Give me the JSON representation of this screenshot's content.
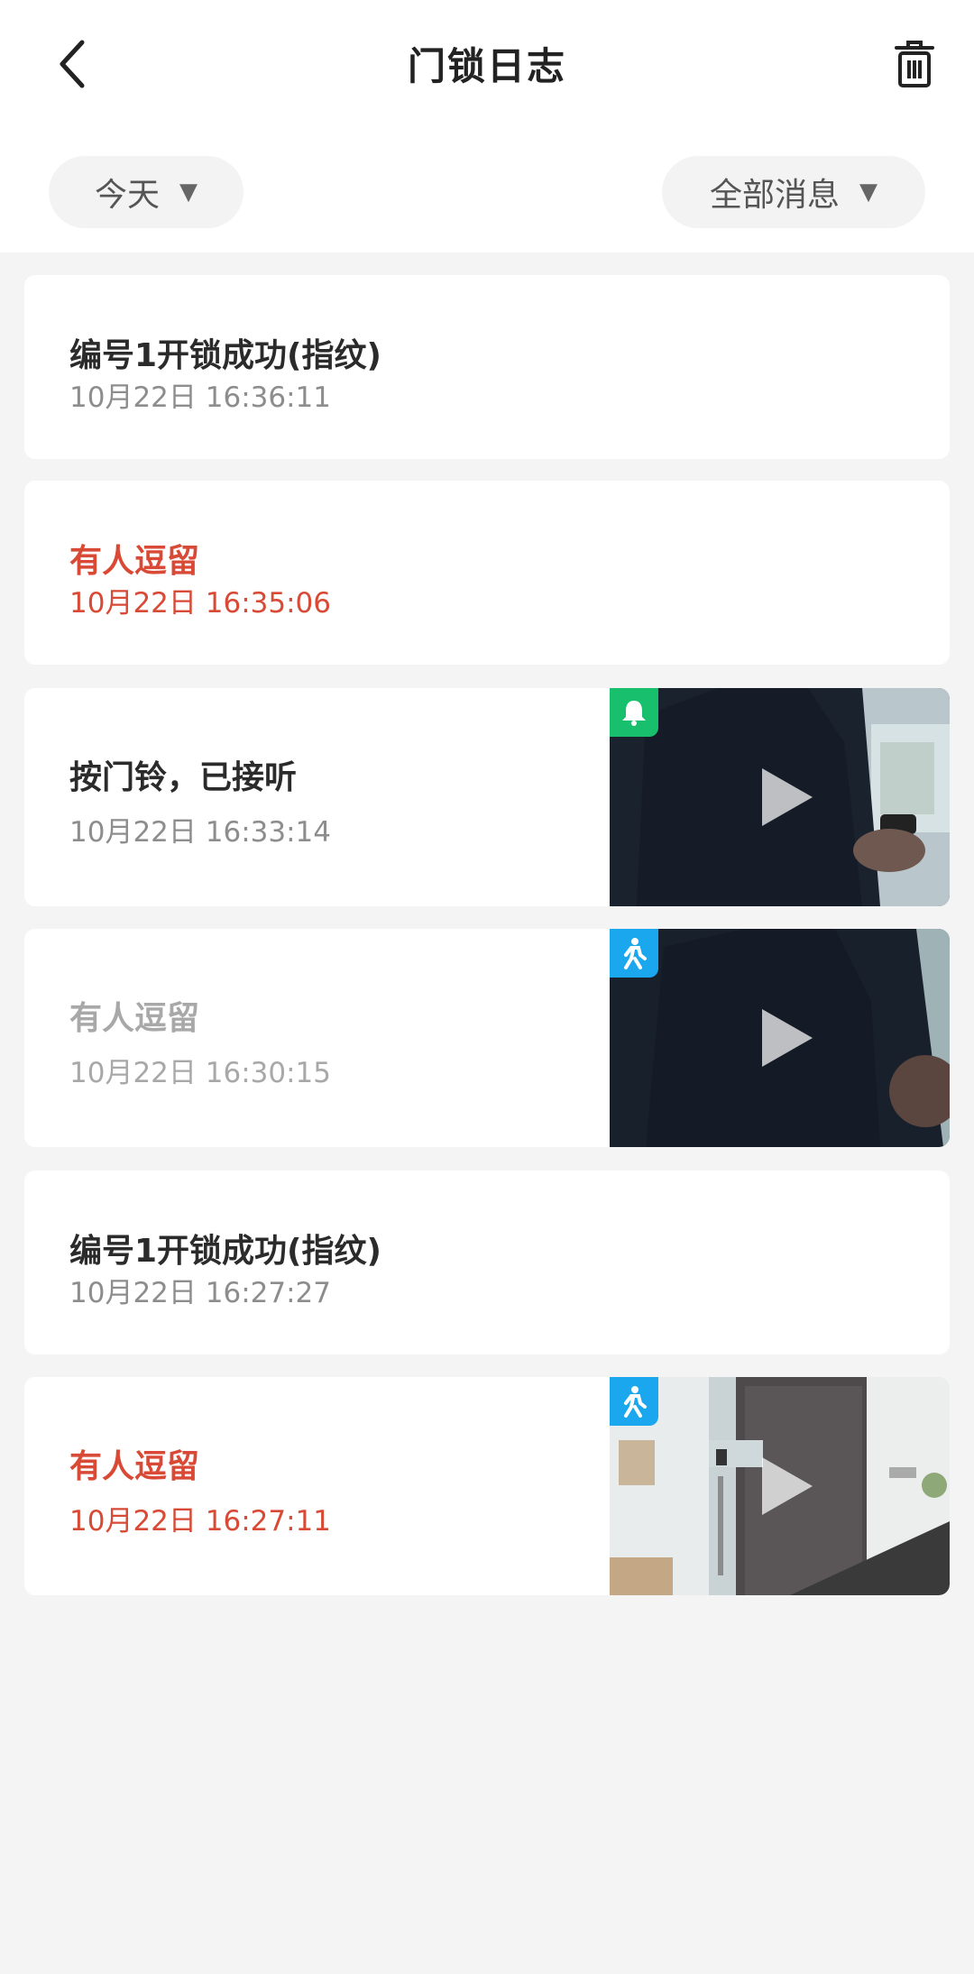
{
  "header": {
    "title": "门锁日志"
  },
  "filters": {
    "date": "今天",
    "type": "全部消息"
  },
  "logs": [
    {
      "title": "编号1开锁成功(指纹)",
      "time": "10月22日 16:36:11",
      "style": "normal",
      "has_video": false
    },
    {
      "title": "有人逗留",
      "time": "10月22日 16:35:06",
      "style": "alert",
      "has_video": false
    },
    {
      "title": "按门铃，已接听",
      "time": "10月22日 16:33:14",
      "style": "normal",
      "has_video": true,
      "badge_icon": "bell-icon",
      "badge_color": "#18c06e"
    },
    {
      "title": "有人逗留",
      "time": "10月22日 16:30:15",
      "style": "muted",
      "has_video": true,
      "badge_icon": "person-icon",
      "badge_color": "#1aa7ee"
    },
    {
      "title": "编号1开锁成功(指纹)",
      "time": "10月22日 16:27:27",
      "style": "normal",
      "has_video": false
    },
    {
      "title": "有人逗留",
      "time": "10月22日 16:27:11",
      "style": "alert",
      "has_video": true,
      "badge_icon": "person-icon",
      "badge_color": "#1aa7ee"
    }
  ],
  "colors": {
    "alert": "#d84a35",
    "muted": "#a8a8a8",
    "background": "#f4f4f4"
  }
}
